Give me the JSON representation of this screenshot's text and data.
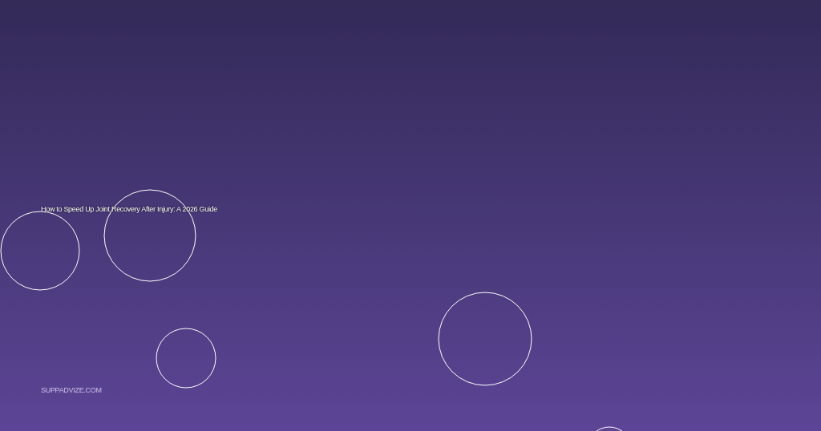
{
  "title": "How to Speed Up Joint Recovery After Injury: A 2026 Guide",
  "site": "SUPPADVIZE.COM"
}
